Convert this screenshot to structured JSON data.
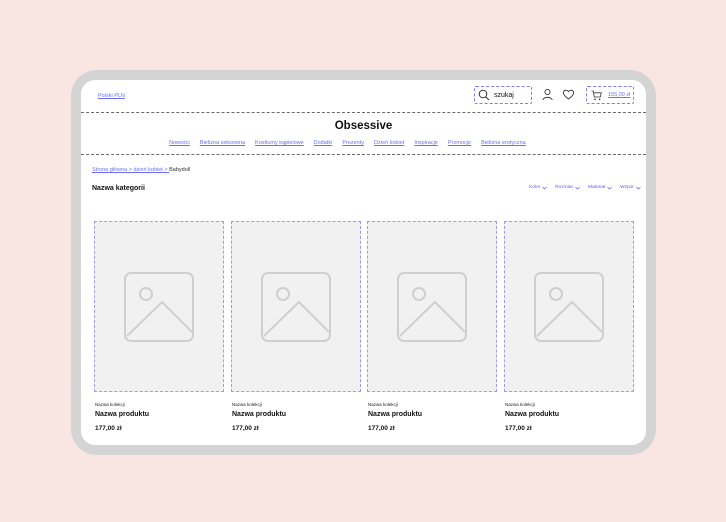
{
  "header": {
    "currency": "Polski PLN",
    "search_label": "szukaj",
    "cart_total": "155,00 zł"
  },
  "brand": "Obsessive",
  "nav": [
    "Nowości",
    "Bielizna seksowna",
    "Kostiumy kąpielowe",
    "Dodatki",
    "Prezenty",
    "Dzień kobiet",
    "Inspiracje",
    "Promocje",
    "Bielizna erotyczna"
  ],
  "breadcrumb": {
    "home": "Strona główna",
    "sep1": " > ",
    "parent": "dzień kobiet",
    "sep2": " > ",
    "current": "Babydoll"
  },
  "category_title": "Nazwa kategorii",
  "filters": [
    "Kolor",
    "Rozmiar",
    "Materiał",
    "Wzpor"
  ],
  "products": [
    {
      "collection": "Nazwa kolekcji",
      "name": "Nazwa produktu",
      "price": "177,00 zł"
    },
    {
      "collection": "Nazwa kolekcji",
      "name": "Nazwa produktu",
      "price": "177,00 zł"
    },
    {
      "collection": "Nazwa kolekcji",
      "name": "Nazwa produktu",
      "price": "177,00 zł"
    },
    {
      "collection": "Nazwa kolekcji",
      "name": "Nazwa produktu",
      "price": "177,00 zł"
    }
  ],
  "colors": {
    "page_bg": "#f9e6e3",
    "frame": "#d4d4d4",
    "link": "#6b6ef5",
    "placeholder_bg": "#f1f1f1"
  }
}
